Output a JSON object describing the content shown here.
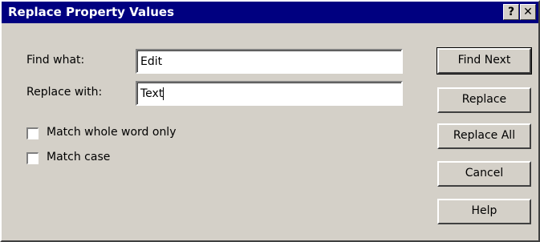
{
  "window": {
    "title": "Replace Property Values",
    "help_glyph": "?",
    "close_glyph": "✕"
  },
  "find_label": "Find what:",
  "find_value": "Edit",
  "replace_label": "Replace with:",
  "replace_value": "Text",
  "options": {
    "whole_word": {
      "label": "Match whole word only",
      "checked": false
    },
    "match_case": {
      "label": "Match case",
      "checked": false
    }
  },
  "buttons": {
    "find_next": "Find Next",
    "replace": "Replace",
    "replace_all": "Replace All",
    "cancel": "Cancel",
    "help": "Help"
  },
  "colors": {
    "titlebar": "#000080",
    "face": "#d4d0c8"
  }
}
